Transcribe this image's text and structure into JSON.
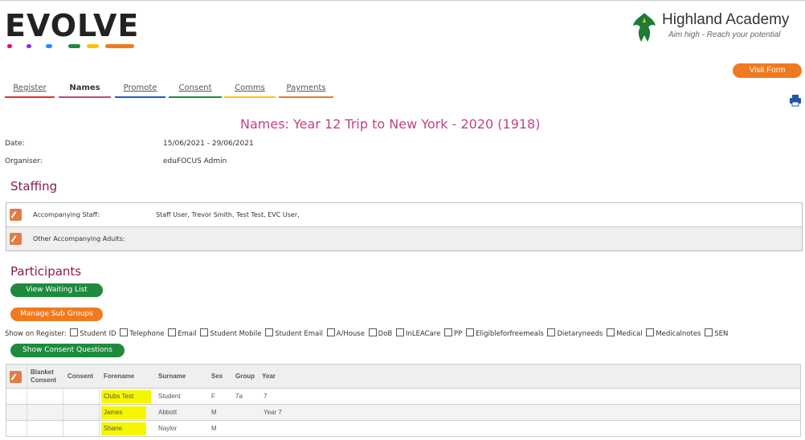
{
  "logo": {
    "text": "EVOLVE",
    "dot_colors": [
      "#e6007e",
      "#8a2be2",
      "#1e90ff",
      "#1e8a3d",
      "#ffc107",
      "#f07a20"
    ]
  },
  "school": {
    "name": "Highland Academy",
    "motto": "Aim high - Reach your potential"
  },
  "visit_form_label": "Visit Form",
  "tabs": [
    {
      "label": "Register",
      "color": "#e0312f"
    },
    {
      "label": "Names",
      "color": "#c3427f",
      "active": true
    },
    {
      "label": "Promote",
      "color": "#1f57c3"
    },
    {
      "label": "Consent",
      "color": "#1e8a3d"
    },
    {
      "label": "Comms",
      "color": "#ffc107"
    },
    {
      "label": "Payments",
      "color": "#f07a20"
    }
  ],
  "print_icon": "printer-icon",
  "page_title": "Names: Year 12 Trip to New York - 2020 (1918)",
  "details": {
    "date_label": "Date:",
    "date_value": "15/06/2021 - 29/06/2021",
    "organiser_label": "Organiser:",
    "organiser_value": "eduFOCUS Admin"
  },
  "staffing": {
    "heading": "Staffing",
    "rows": [
      {
        "label": "Accompanying Staff:",
        "value": "Staff User, Trevor Smith, Test Test, EVC User,"
      },
      {
        "label": "Other Accompanying Adults:",
        "value": ""
      }
    ]
  },
  "participants": {
    "heading": "Participants",
    "view_waiting_list": "View Waiting List",
    "manage_sub_groups": "Manage Sub Groups",
    "show_consent_questions": "Show Consent Questions",
    "show_on_register_label": "Show on Register:",
    "register_options": [
      "Student ID",
      "Telephone",
      "Email",
      "Student Mobile",
      "Student Email",
      "A/House",
      "DoB",
      "InLEACare",
      "PP",
      "Eligibleforfreemeals",
      "Dietaryneeds",
      "Medical",
      "Medicalnotes",
      "SEN"
    ]
  },
  "table": {
    "headers": {
      "blanket1": "Blanket",
      "blanket2": "Consent",
      "consent": "Consent",
      "forename": "Forename",
      "surname": "Surname",
      "sex": "Sex",
      "group": "Group",
      "year": "Year"
    },
    "rows": [
      {
        "forename": "Clubs Test",
        "surname": "Student",
        "sex": "F",
        "group": "7a",
        "year": "7"
      },
      {
        "forename": "James",
        "surname": "Abbott",
        "sex": "M",
        "group": "",
        "year": "Year 7"
      },
      {
        "forename": "Shane",
        "surname": "Naylor",
        "sex": "M",
        "group": "",
        "year": ""
      }
    ]
  }
}
